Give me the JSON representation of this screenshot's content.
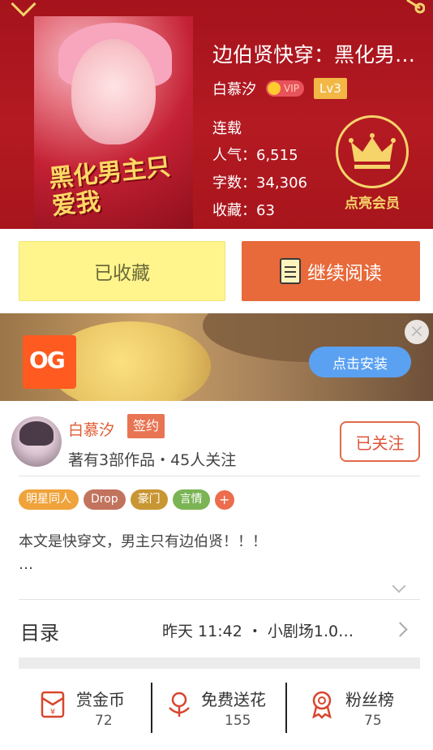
{
  "book": {
    "title": "边伯贤快穿：黑化男…",
    "author": "白慕汐",
    "vip_label": "VIP",
    "level": "Lv3",
    "status": "连载",
    "popularity": "人气：6,515",
    "word_count": "字数：34,306",
    "favorites": "收藏：63",
    "cover_art_text": "黑化男主只爱我"
  },
  "member": {
    "label": "点亮会员"
  },
  "actions": {
    "favorited_label": "已收藏",
    "continue_label": "继续阅读"
  },
  "ad": {
    "install_label": "点击安装",
    "close_glyph": "×",
    "logo_text": "OG"
  },
  "author_section": {
    "name": "白慕汐",
    "sign_label": "签约",
    "works": "著有3部作品・45人关注",
    "follow_label": "已关注"
  },
  "tags": [
    {
      "label": "明星同人",
      "color": "#efa33a"
    },
    {
      "label": "Drop",
      "color": "#c2735e"
    },
    {
      "label": "豪门",
      "color": "#c99634"
    },
    {
      "label": "言情",
      "color": "#7ab454"
    }
  ],
  "tag_more": "+",
  "intro": {
    "line1": "本文是快穿文，男主只有边伯贤！！！",
    "line2": "…"
  },
  "catalog": {
    "label": "目录",
    "info": "昨天 11:42 ・ 小剧场1.0…"
  },
  "stats": [
    {
      "label": "赏金币",
      "value": "72",
      "icon": "reward-icon"
    },
    {
      "label": "免费送花",
      "value": "155",
      "icon": "flower-icon"
    },
    {
      "label": "粉丝榜",
      "value": "75",
      "icon": "medal-icon"
    }
  ],
  "colors": {
    "header_red": "#a8151c",
    "accent_orange": "#e8693a",
    "gold": "#f6d46a"
  }
}
